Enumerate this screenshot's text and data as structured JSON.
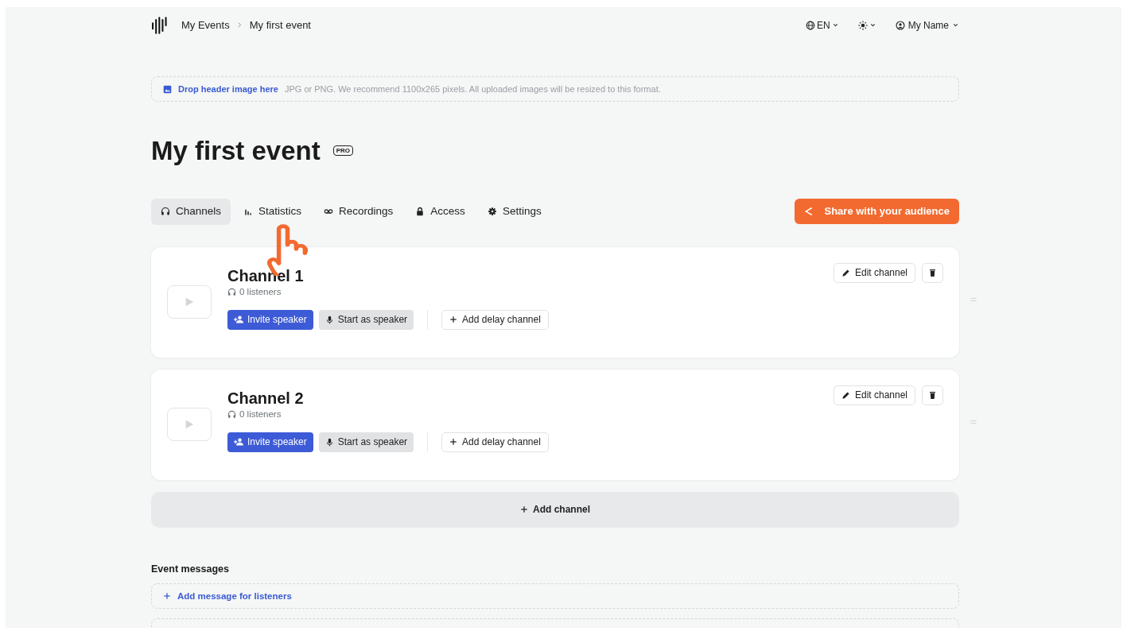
{
  "breadcrumb": [
    {
      "label": "My Events"
    },
    {
      "label": "My first event"
    }
  ],
  "topbar": {
    "language": "EN",
    "user": "My Name"
  },
  "header_drop": {
    "link": "Drop header image here",
    "hint": "JPG or PNG. We recommend 1100x265 pixels. All uploaded images will be resized to this format."
  },
  "title": "My first event",
  "title_badge": "PRO",
  "tabs": [
    {
      "label": "Channels",
      "selected": true
    },
    {
      "label": "Statistics",
      "selected": false
    },
    {
      "label": "Recordings",
      "selected": false
    },
    {
      "label": "Access",
      "selected": false
    },
    {
      "label": "Settings",
      "selected": false
    }
  ],
  "share_button": "Share with your audience",
  "channels": [
    {
      "name": "Channel 1",
      "listeners": "0 listeners",
      "invite": "Invite speaker",
      "start": "Start as speaker",
      "delay": "Add delay channel",
      "edit": "Edit channel"
    },
    {
      "name": "Channel 2",
      "listeners": "0 listeners",
      "invite": "Invite speaker",
      "start": "Start as speaker",
      "delay": "Add delay channel",
      "edit": "Edit channel"
    }
  ],
  "add_channel": "Add channel",
  "event_messages": {
    "heading": "Event messages",
    "add": "Add message for listeners"
  }
}
